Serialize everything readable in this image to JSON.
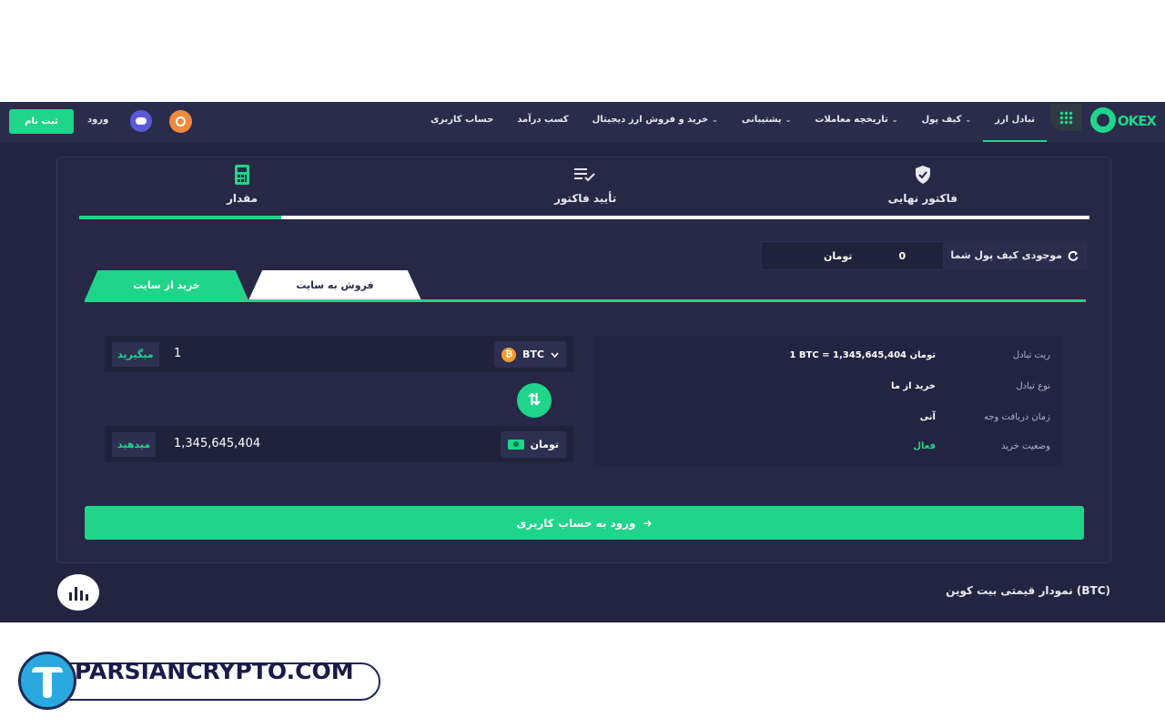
{
  "nav": {
    "logo_text": "OKEX",
    "items": [
      {
        "label": "تبادل ارز",
        "caret": ""
      },
      {
        "label": "کیف پول",
        "caret": "⌄"
      },
      {
        "label": "تاریخچه معاملات",
        "caret": "⌄"
      },
      {
        "label": "پشتیبانی",
        "caret": "⌄"
      },
      {
        "label": "خرید و فروش ارز دیجیتال",
        "caret": "⌄"
      },
      {
        "label": "کسب درآمد",
        "caret": ""
      },
      {
        "label": "حساب کاربری",
        "caret": ""
      }
    ],
    "login": "ورود",
    "signup": "ثبت نام"
  },
  "steps": {
    "final_invoice": "فاکتور نهایی",
    "confirm_invoice": "تأیید فاکتور",
    "amount": "مقدار",
    "progress_fraction": 0.2
  },
  "balance": {
    "label": "موجودی کیف پول شما",
    "value": "0",
    "unit": "تومان"
  },
  "trade_tabs": {
    "buy": "خرید از سایت",
    "sell": "فروش به سایت"
  },
  "converter": {
    "receive_action": "میگیرید",
    "receive_value": "1",
    "receive_currency": "BTC",
    "btc_symbol": "₿",
    "pay_action": "میدهید",
    "pay_value": "1,345,645,404",
    "pay_currency": "تومان",
    "swap_symbol": "⇅"
  },
  "info": {
    "rate_label": "ریت تبادل",
    "rate_value": "1 BTC = 1,345,645,404 تومان",
    "type_label": "نوع تبادل",
    "type_value": "خرید از ما",
    "time_label": "زمان دریافت وجه",
    "time_value": "آنی",
    "status_label": "وضعیت خرید",
    "status_value": "فعال"
  },
  "login_button": {
    "label": "ورود به حساب کاربری",
    "arrow": "➜"
  },
  "chart_section": {
    "title": "نمودار قیمتی بیت کوین (BTC)"
  },
  "watermark": {
    "text": "PARSIANCRYPTO.COM"
  },
  "colors": {
    "accent": "#1fd58a",
    "background": "#232540",
    "navbar": "#2a2c4b"
  }
}
